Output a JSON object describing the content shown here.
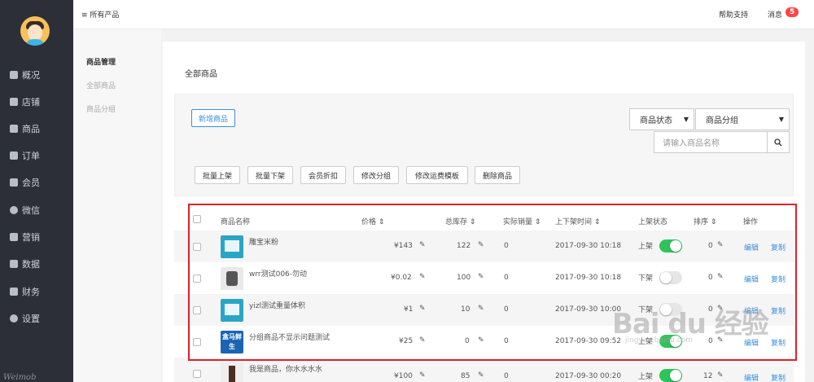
{
  "sidebar": {
    "items": [
      {
        "label": "概况",
        "icon": "list-icon"
      },
      {
        "label": "店铺",
        "icon": "store-icon"
      },
      {
        "label": "商品",
        "icon": "goods-icon"
      },
      {
        "label": "订单",
        "icon": "order-icon"
      },
      {
        "label": "会员",
        "icon": "member-icon"
      },
      {
        "label": "微信",
        "icon": "wechat-icon"
      },
      {
        "label": "营销",
        "icon": "marketing-icon"
      },
      {
        "label": "数据",
        "icon": "chart-icon"
      },
      {
        "label": "财务",
        "icon": "finance-icon"
      },
      {
        "label": "设置",
        "icon": "settings-icon"
      }
    ],
    "logo": "Weimob"
  },
  "topbar": {
    "menu": "≡ 所有产品",
    "help": "帮助支持",
    "messages": "消息",
    "badge": "5"
  },
  "subnav": {
    "title": "商品管理",
    "items": [
      "全部商品",
      "商品分组"
    ]
  },
  "page": {
    "title": "全部商品"
  },
  "toolbar": {
    "new": "新增商品",
    "status": "商品状态",
    "group": "商品分组",
    "search_placeholder": "请输入商品名称",
    "batch": [
      "批量上架",
      "批量下架",
      "会员折扣",
      "修改分组",
      "修改运费模板",
      "删除商品"
    ]
  },
  "table": {
    "headers": {
      "name": "商品名称",
      "price": "价格 ⇕",
      "stock": "总库存 ⇕",
      "sales": "实际销量 ⇕",
      "time": "上下架时间 ⇕",
      "status": "上架状态",
      "sort": "排序 ⇕",
      "ops": "操作"
    },
    "rows": [
      {
        "name": "雕宝米粉",
        "price": "¥143",
        "stock": "122",
        "sales": "0",
        "time": "2017-09-30 10:18",
        "status": "上架",
        "on": true,
        "sort": "0",
        "edit": "编辑",
        "copy": "复制"
      },
      {
        "name": "wrr测试006-勿动",
        "price": "¥0.02",
        "stock": "100",
        "sales": "0",
        "time": "2017-09-30 10:18",
        "status": "下架",
        "on": false,
        "sort": "0",
        "edit": "编辑",
        "copy": "复制"
      },
      {
        "name": "yizl测试重量体积",
        "price": "¥1",
        "stock": "10",
        "sales": "0",
        "time": "2017-09-30 10:00",
        "status": "下架",
        "on": false,
        "sort": "0",
        "edit": "编辑",
        "copy": "复制"
      },
      {
        "name": "分组商品不显示问题测试",
        "price": "¥25",
        "stock": "0",
        "sales": "0",
        "time": "2017-09-30 09:52",
        "status": "上架",
        "on": true,
        "sort": "0",
        "edit": "编辑",
        "copy": "复制"
      },
      {
        "name": "我是商品，你水水水水",
        "price": "¥100",
        "stock": "85",
        "sales": "0",
        "time": "2017-09-30 00:20",
        "status": "上架",
        "on": true,
        "sort": "12",
        "edit": "编辑",
        "copy": "复制"
      }
    ]
  },
  "thumb5_text": "盒马鲜生",
  "watermark": {
    "main": "Bai du 经验",
    "sub": "jingyan.baidu.com"
  },
  "colors": {
    "accent": "#3b8ee0",
    "toggle_on": "#2fc45b",
    "highlight": "#e0202a",
    "sidebar": "#2d2f38"
  }
}
